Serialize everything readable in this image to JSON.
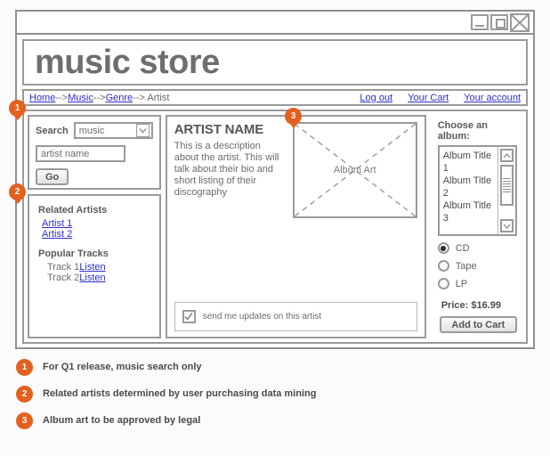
{
  "window": {
    "controls": [
      {
        "name": "minimize-button",
        "icon": "minimize-icon"
      },
      {
        "name": "maximize-button",
        "icon": "maximize-icon"
      },
      {
        "name": "close-button",
        "icon": "close-icon"
      }
    ]
  },
  "banner": {
    "title": "music store"
  },
  "nav": {
    "breadcrumb": [
      {
        "label": "Home",
        "link": true
      },
      {
        "label": "-->",
        "link": false
      },
      {
        "label": "Music",
        "link": true
      },
      {
        "label": "-->",
        "link": false
      },
      {
        "label": "Genre",
        "link": true
      },
      {
        "label": "--> ",
        "link": false
      },
      {
        "label": "Artist",
        "link": false
      }
    ],
    "account_links": [
      "Log out",
      "Your Cart",
      "Your account"
    ]
  },
  "search": {
    "label": "Search",
    "category_value": "music",
    "category_options": [
      "music"
    ],
    "artist_input_value": "artist name",
    "go_label": "Go"
  },
  "related": {
    "artists_title": "Related Artists",
    "artists": [
      "Artist 1",
      "Artist 2"
    ],
    "tracks_title": "Popular Tracks",
    "tracks": [
      {
        "name": "Track 1",
        "action": "Listen"
      },
      {
        "name": "Track 2",
        "action": "Listen"
      }
    ]
  },
  "artist": {
    "name": "ARTIST NAME",
    "description": "This is a description about the artist.  This will talk about their bio and short listing of their discography",
    "album_art_label": "Album Art"
  },
  "updates": {
    "checked": true,
    "label": "send me updates on this artist"
  },
  "album_panel": {
    "choose_label": "Choose an album:",
    "albums": [
      "Album Title 1",
      "Album Title 2",
      "Album Title 3"
    ],
    "formats": [
      {
        "label": "CD",
        "selected": true
      },
      {
        "label": "Tape",
        "selected": false
      },
      {
        "label": "LP",
        "selected": false
      }
    ],
    "price": "Price: $16.99",
    "add_to_cart_label": "Add to Cart"
  },
  "notes": [
    {
      "number": "1",
      "text": "For Q1 release, music search only"
    },
    {
      "number": "2",
      "text": "Related artists determined by user purchasing data mining"
    },
    {
      "number": "3",
      "text": "Album art to be approved by legal"
    }
  ],
  "badges": [
    {
      "number": "1"
    },
    {
      "number": "2"
    },
    {
      "number": "3"
    }
  ],
  "colors": {
    "accent": "#e4601f",
    "link": "#2d2dd0",
    "border": "#9a9a9a",
    "text": "#6b6b6b"
  }
}
